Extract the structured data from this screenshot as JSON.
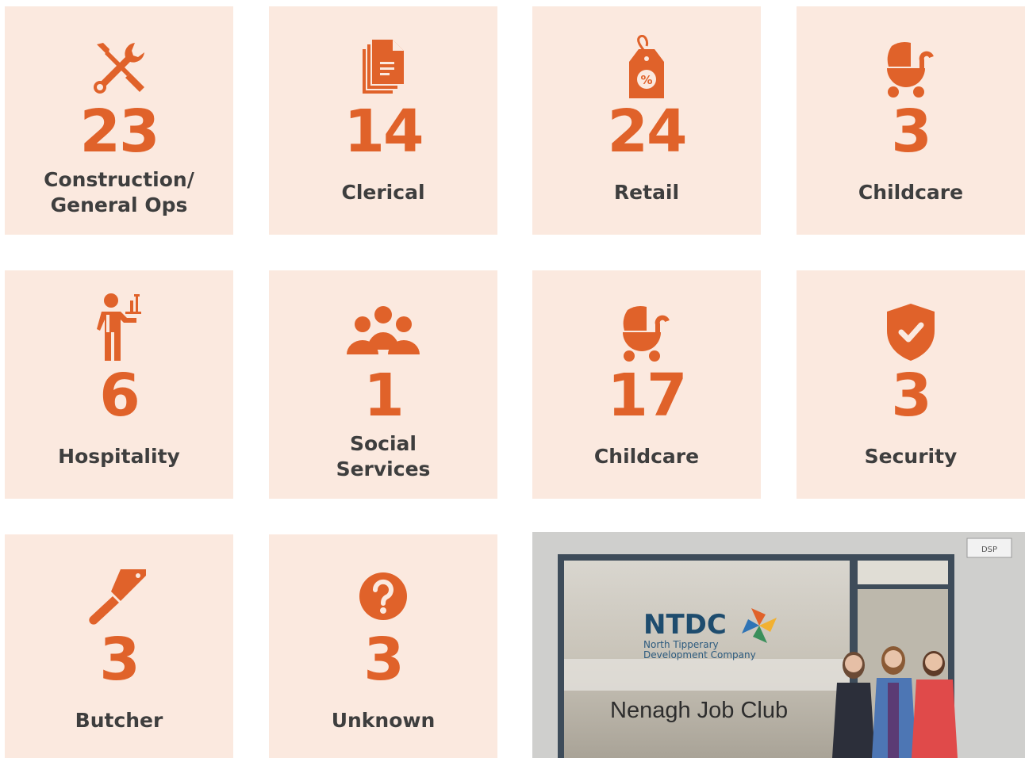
{
  "accent_color": "#e0622a",
  "tile_background": "#fbe9df",
  "tiles": [
    {
      "icon": "tools-icon",
      "count": "23",
      "label": "Construction/\nGeneral Ops"
    },
    {
      "icon": "documents-icon",
      "count": "14",
      "label": "Clerical"
    },
    {
      "icon": "price-tag-icon",
      "count": "24",
      "label": "Retail"
    },
    {
      "icon": "pram-icon",
      "count": "3",
      "label": "Childcare"
    },
    {
      "icon": "waiter-icon",
      "count": "6",
      "label": "Hospitality"
    },
    {
      "icon": "group-icon",
      "count": "1",
      "label": "Social\nServices"
    },
    {
      "icon": "pram-icon",
      "count": "17",
      "label": "Childcare"
    },
    {
      "icon": "shield-check-icon",
      "count": "3",
      "label": "Security"
    },
    {
      "icon": "cleaver-icon",
      "count": "3",
      "label": "Butcher"
    },
    {
      "icon": "question-icon",
      "count": "3",
      "label": "Unknown"
    }
  ],
  "photo": {
    "logo_text": "NTDC",
    "logo_subtitle_line1": "North Tipperary",
    "logo_subtitle_line2": "Development Company",
    "window_text": "Nenagh Job Club",
    "plaque_text": "DSP"
  }
}
